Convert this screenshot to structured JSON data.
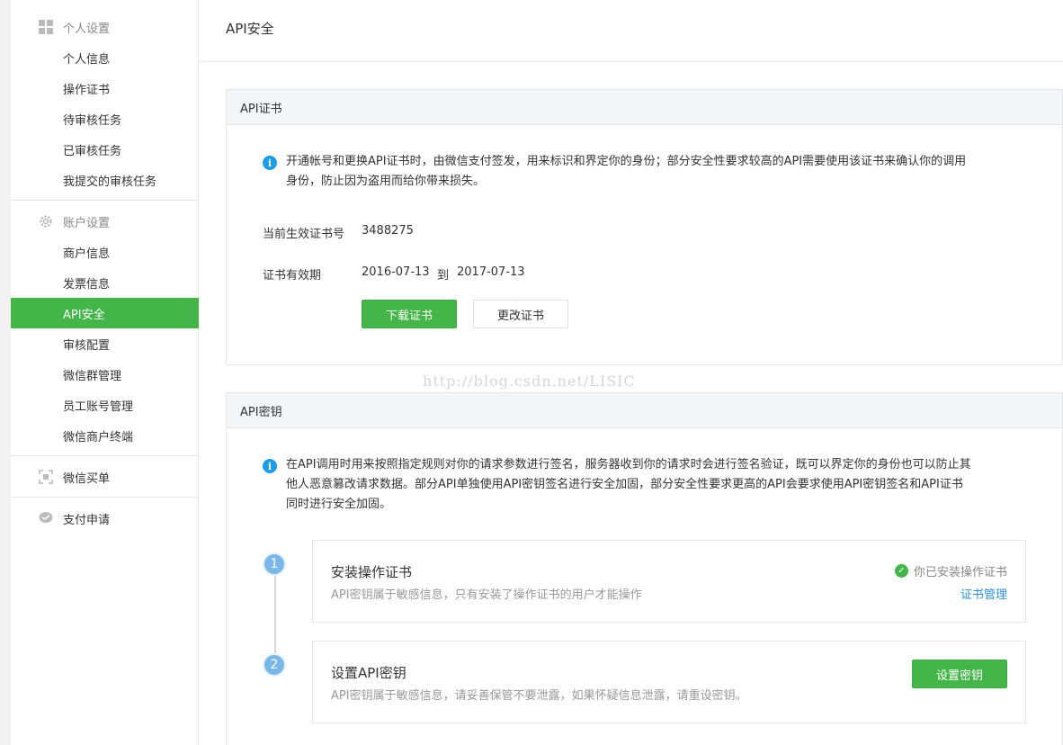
{
  "sidebar": {
    "groups": [
      {
        "label": "个人设置",
        "icon": "grid-icon",
        "items": [
          "个人信息",
          "操作证书",
          "待审核任务",
          "已审核任务",
          "我提交的审核任务"
        ]
      },
      {
        "label": "账户设置",
        "icon": "gear-icon",
        "items": [
          "商户信息",
          "发票信息",
          "API安全",
          "审核配置",
          "微信群管理",
          "员工账号管理",
          "微信商户终端"
        ]
      },
      {
        "label": "微信买单",
        "icon": "scan-icon",
        "items": []
      },
      {
        "label": "支付申请",
        "icon": "chat-bubble-icon",
        "items": []
      }
    ],
    "active_item": "API安全"
  },
  "header": {
    "title": "API安全"
  },
  "cert_panel": {
    "title": "API证书",
    "info_line1": "开通帐号和更换API证书时，由微信支付签发，用来标识和界定你的身份；部分安全性要求较高的API需要使用该证书来确认你的调用",
    "info_line2": "身份，防止因为盗用而给你带来损失。",
    "serial_label": "当前生效证书号",
    "serial_value": "3488275",
    "validity_label": "证书有效期",
    "valid_from": "2016-07-13",
    "valid_to_word": "到",
    "valid_to": "2017-07-13",
    "download_btn": "下载证书",
    "change_btn": "更改证书"
  },
  "watermark": "http://blog.csdn.net/LISIC",
  "key_panel": {
    "title": "API密钥",
    "info_line1": "在API调用时用来按照指定规则对你的请求参数进行签名，服务器收到你的请求时会进行签名验证，既可以界定你的身份也可以防止其",
    "info_line2": "他人恶意篡改请求数据。部分API单独使用API密钥签名进行安全加固，部分安全性要求更高的API会要求使用API密钥签名和API证书",
    "info_line3": "同时进行安全加固。",
    "steps": [
      {
        "num": "1",
        "title": "安装操作证书",
        "desc": "API密钥属于敏感信息，只有安装了操作证书的用户才能操作",
        "status": "你已安装操作证书",
        "link": "证书管理"
      },
      {
        "num": "2",
        "title": "设置API密钥",
        "desc": "API密钥属于敏感信息，请妥善保管不要泄露，如果怀疑信息泄露，请重设密钥。",
        "button": "设置密钥"
      }
    ]
  },
  "colors": {
    "accent_green": "#44b549",
    "info_blue": "#1c9ce6",
    "step_blue": "#7ab6e8",
    "link_blue": "#2a90d8"
  }
}
